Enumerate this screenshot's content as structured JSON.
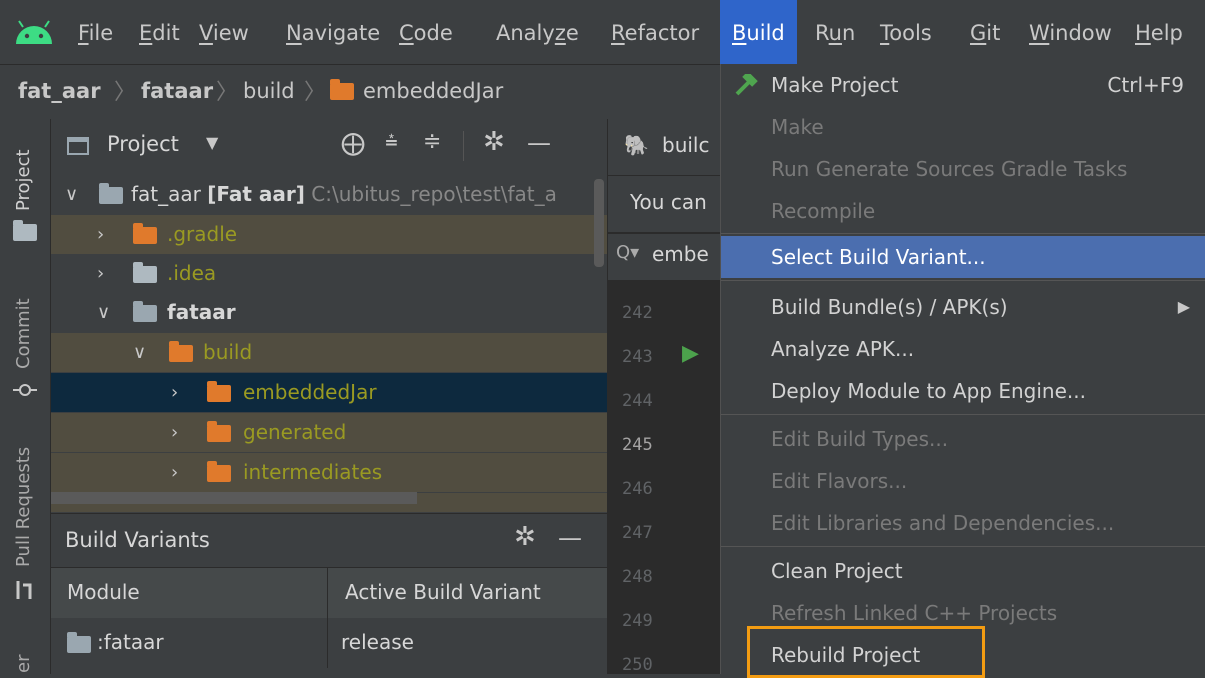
{
  "menubar": {
    "items": [
      {
        "label": "File",
        "u": 0
      },
      {
        "label": "Edit",
        "u": 0
      },
      {
        "label": "View",
        "u": 0
      },
      {
        "label": "Navigate",
        "u": 0
      },
      {
        "label": "Code",
        "u": 0
      },
      {
        "label": "Analyze",
        "u": 5
      },
      {
        "label": "Refactor",
        "u": 0
      },
      {
        "label": "Build",
        "u": 0
      },
      {
        "label": "Run",
        "u": 1
      },
      {
        "label": "Tools",
        "u": 0
      },
      {
        "label": "Git",
        "u": 0
      },
      {
        "label": "Window",
        "u": 0
      },
      {
        "label": "Help",
        "u": 0
      }
    ],
    "active": "Build"
  },
  "breadcrumb": {
    "items": [
      "fat_aar",
      "fataar",
      "build",
      "embeddedJar"
    ]
  },
  "stripe": {
    "tabs": [
      "Project",
      "Commit",
      "Pull Requests",
      "er"
    ]
  },
  "project_panel": {
    "title": "Project",
    "root_name": "fat_aar",
    "root_module": "[Fat aar]",
    "root_path": "C:\\ubitus_repo\\test\\fat_a",
    "rows": [
      ".gradle",
      ".idea",
      "fataar",
      "build",
      "embeddedJar",
      "generated",
      "intermediates"
    ]
  },
  "build_variants": {
    "title": "Build Variants",
    "col_module": "Module",
    "col_variant": "Active Build Variant",
    "row_module": ":fataar",
    "row_variant": "release"
  },
  "editor": {
    "tab_label": "builc",
    "info_text": "You can",
    "search_text": "embe",
    "line_numbers": [
      "242",
      "243",
      "244",
      "245",
      "246",
      "247",
      "248",
      "249",
      "250"
    ]
  },
  "build_menu": {
    "items": [
      {
        "label": "Make Project",
        "shortcut": "Ctrl+F9",
        "state": "enabled"
      },
      {
        "label": "Make",
        "state": "disabled"
      },
      {
        "label": "Run Generate Sources Gradle Tasks",
        "state": "disabled"
      },
      {
        "label": "Recompile",
        "state": "disabled"
      },
      {
        "label": "Select Build Variant...",
        "state": "selected"
      },
      {
        "label": "Build Bundle(s) / APK(s)",
        "state": "enabled",
        "submenu": true
      },
      {
        "label": "Analyze APK...",
        "state": "enabled"
      },
      {
        "label": "Deploy Module to App Engine...",
        "state": "enabled"
      },
      {
        "label": "Edit Build Types...",
        "state": "disabled"
      },
      {
        "label": "Edit Flavors...",
        "state": "disabled"
      },
      {
        "label": "Edit Libraries and Dependencies...",
        "state": "disabled"
      },
      {
        "label": "Clean Project",
        "state": "enabled"
      },
      {
        "label": "Refresh Linked C++ Projects",
        "state": "disabled"
      },
      {
        "label": "Rebuild Project",
        "state": "enabled",
        "highlight": "#f39c12"
      }
    ]
  },
  "colors": {
    "accent": "#2f65ca",
    "selection": "#4b6eaf",
    "highlight_box": "#f39c12",
    "android_green": "#3ddc84"
  }
}
